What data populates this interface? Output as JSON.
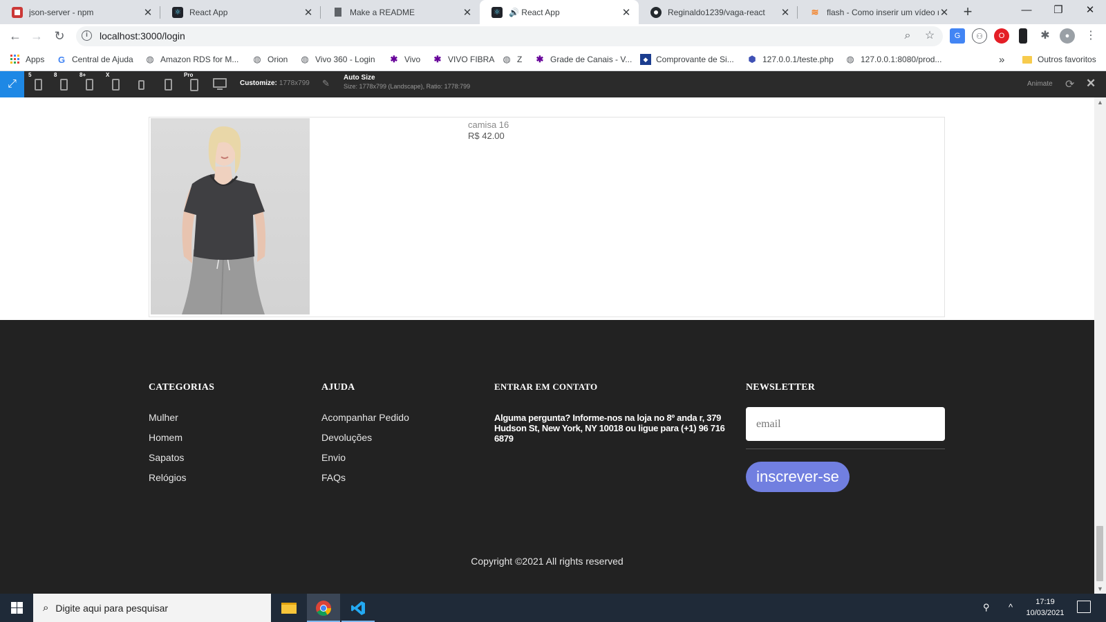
{
  "browser": {
    "tabs": [
      {
        "title": "json-server - npm",
        "close": "✕"
      },
      {
        "title": "React App",
        "close": "✕"
      },
      {
        "title": "Make a README",
        "close": "✕"
      },
      {
        "title": "🔊 React App",
        "close": "✕"
      },
      {
        "title": "Reginaldo1239/vaga-react",
        "close": "✕"
      },
      {
        "title": "flash - Como inserir um vídeo n",
        "close": "✕"
      }
    ],
    "new_tab": "+",
    "window_buttons": {
      "minimize": "—",
      "restore": "❐",
      "close": "✕"
    },
    "url": "localhost:3000/login",
    "bookmarks": [
      "Apps",
      "Central de Ajuda",
      "Amazon RDS for M...",
      "Orion",
      "Vivo 360 - Login",
      "Vivo",
      "VIVO FIBRA",
      "Z",
      "Grade de Canais - V...",
      "Comprovante de Si...",
      "127.0.0.1/teste.php",
      "127.0.0.1:8080/prod..."
    ],
    "bookmarks_overflow": "»",
    "other_bookmarks": "Outros favoritos"
  },
  "devtools": {
    "device_labels": [
      "5",
      "8",
      "8+",
      "X",
      "",
      "",
      "Pro",
      ""
    ],
    "customize_label": "Customize:",
    "customize_value": "1778x799",
    "auto_size_title": "Auto Size",
    "auto_size_detail": "Size: 1778x799 (Landscape), Ratio: 1778:799",
    "animate_label": "Animate"
  },
  "product": {
    "name": "camisa 16",
    "price": "R$ 42.00"
  },
  "footer": {
    "categorias": {
      "title": "CATEGORIAS",
      "links": [
        "Mulher",
        "Homem",
        "Sapatos",
        "Relógios"
      ]
    },
    "ajuda": {
      "title": "AJUDA",
      "links": [
        "Acompanhar Pedido",
        "Devoluções",
        "Envio",
        "FAQs"
      ]
    },
    "contato": {
      "title": "ENTRAR EM CONTATO",
      "text": "Alguma pergunta? Informe-nos na loja no 8º anda r, 379 Hudson St, New York, NY 10018 ou ligue para (+1) 96 716 6879"
    },
    "newsletter": {
      "title": "NEWSLETTER",
      "placeholder": "email",
      "button": "inscrever-se"
    },
    "copyright": "Copyright ©2021 All rights reserved"
  },
  "taskbar": {
    "search_placeholder": "Digite aqui para pesquisar",
    "time": "17:19",
    "date": "10/03/2021"
  },
  "colors": {
    "footer_bg": "#222222",
    "button_accent": "#717fe0",
    "devtools_active": "#1e88e5",
    "taskbar_bg": "#1f2a38"
  }
}
